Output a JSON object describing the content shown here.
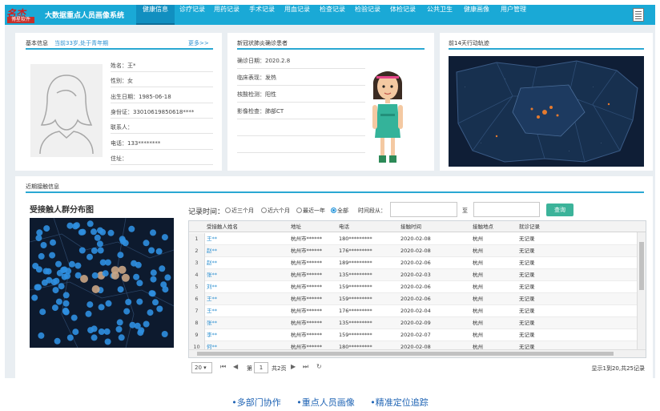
{
  "app": {
    "logo_text": "名杰",
    "logo_sub": "博星软件",
    "title": "大数据重点人员画像系统"
  },
  "nav": {
    "items": [
      "健康信息",
      "诊疗记录",
      "用药记录",
      "手术记录",
      "用血记录",
      "检查记录",
      "检验记录",
      "体检记录",
      "公共卫生",
      "健康画像",
      "用户管理"
    ],
    "active_index": 0
  },
  "basic": {
    "heading": "基本信息",
    "tag": "当前33岁,处于青年期",
    "more": "更多>>",
    "rows": [
      "姓名：王*",
      "性别：女",
      "出生日期：1985-06-18",
      "身份证：33010619850618****",
      "联系人：",
      "电话：133********",
      "住址："
    ]
  },
  "covid": {
    "heading": "新冠状肺炎确诊患者",
    "rows": [
      "确诊日期：2020.2.8",
      "临床表现：发热",
      "核酸检测：阳性",
      "影像检查：肺部CT",
      "",
      ""
    ]
  },
  "track": {
    "heading": "前14天行动轨迹"
  },
  "contacts": {
    "heading": "近期接触信息",
    "dist_title": "受接触人群分布图",
    "record_time_label": "记录时间：",
    "ranges": [
      "近三个月",
      "近六个月",
      "最近一年",
      "全部"
    ],
    "selected_range": 3,
    "time_span_label": "时间段从：",
    "to_label": "至",
    "from_value": "",
    "to_value": "",
    "query_button": "查询"
  },
  "table": {
    "columns": [
      "受接触人姓名",
      "地址",
      "电话",
      "接触时间",
      "接触地点",
      "就诊记录"
    ],
    "rows": [
      [
        "1",
        "王**",
        "杭州市******",
        "180*********",
        "2020-02-08",
        "杭州",
        "无记录"
      ],
      [
        "2",
        "赵**",
        "杭州市******",
        "176*********",
        "2020-02-08",
        "杭州",
        "无记录"
      ],
      [
        "3",
        "赵**",
        "杭州市******",
        "189*********",
        "2020-02-06",
        "杭州",
        "无记录"
      ],
      [
        "4",
        "张**",
        "杭州市******",
        "135*********",
        "2020-02-03",
        "杭州",
        "无记录"
      ],
      [
        "5",
        "刘**",
        "杭州市******",
        "159*********",
        "2020-02-06",
        "杭州",
        "无记录"
      ],
      [
        "6",
        "王**",
        "杭州市******",
        "159*********",
        "2020-02-06",
        "杭州",
        "无记录"
      ],
      [
        "7",
        "王**",
        "杭州市******",
        "176*********",
        "2020-02-04",
        "杭州",
        "无记录"
      ],
      [
        "8",
        "张**",
        "杭州市******",
        "135*********",
        "2020-02-09",
        "杭州",
        "无记录"
      ],
      [
        "9",
        "李**",
        "杭州市******",
        "159*********",
        "2020-02-07",
        "杭州",
        "无记录"
      ],
      [
        "10",
        "何**",
        "杭州市******",
        "180*********",
        "2020-02-08",
        "杭州",
        "无记录"
      ]
    ]
  },
  "pager": {
    "page_size": "20",
    "page_prefix": "第",
    "current_page": "1",
    "page_suffix": "共2页",
    "summary": "显示1到20,共25记录"
  },
  "footer": {
    "items": [
      "•多部门协作",
      "•重点人员画像",
      "•精准定位追踪"
    ]
  },
  "colors": {
    "nav_bg": "#1aa9d6",
    "accent_line": "#2aa8d3",
    "query_button": "#3cb39a",
    "map_bg": "#0e1c33",
    "cluster_blue": "#2f8fe0",
    "cluster_tan": "#c9a585",
    "link": "#2b8fd0"
  }
}
